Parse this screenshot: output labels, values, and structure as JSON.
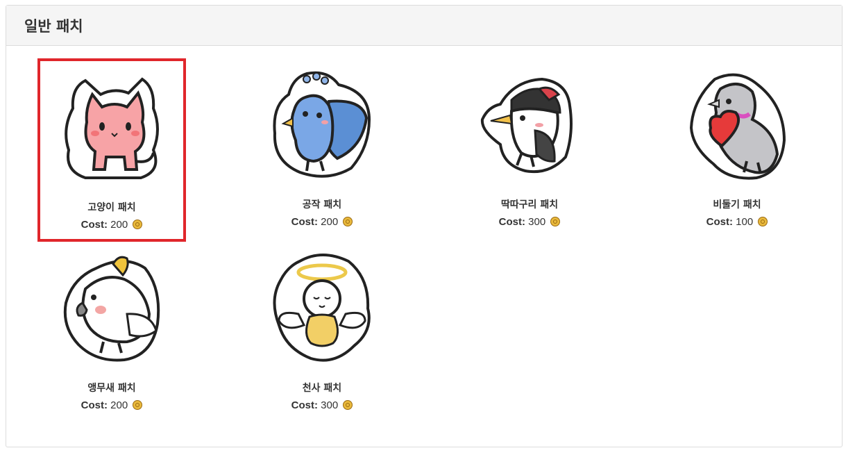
{
  "panel": {
    "title": "일반 패치"
  },
  "cost_label": "Cost:",
  "currency_icon": "coin-icon",
  "selection_color": "#e0262b",
  "items": [
    {
      "name": "고양이 패치",
      "cost": "200",
      "sticker": "pink-cat",
      "selected": true
    },
    {
      "name": "공작 패치",
      "cost": "200",
      "sticker": "blue-peacock",
      "selected": false
    },
    {
      "name": "딱따구리 패치",
      "cost": "300",
      "sticker": "woodpecker",
      "selected": false
    },
    {
      "name": "비둘기 패치",
      "cost": "100",
      "sticker": "pigeon-with-heart",
      "selected": false
    },
    {
      "name": "앵무새 패치",
      "cost": "200",
      "sticker": "white-parrot",
      "selected": false
    },
    {
      "name": "천사 패치",
      "cost": "300",
      "sticker": "angel",
      "selected": false
    }
  ]
}
